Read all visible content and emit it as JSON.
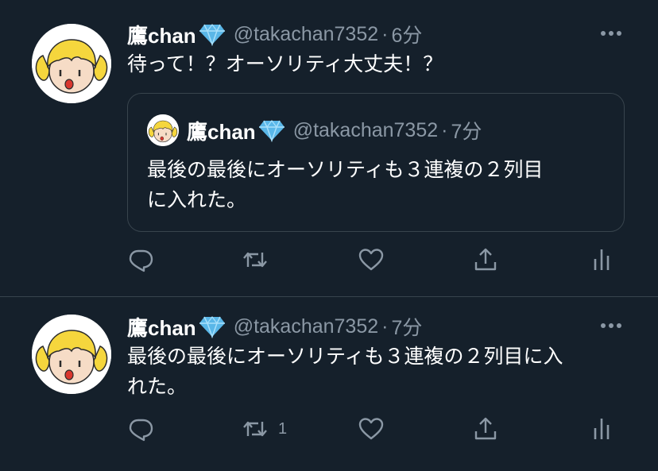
{
  "colors": {
    "background": "#15202b",
    "divider": "#38444d",
    "secondary_text": "#8b98a5",
    "gem_blue": "#5ab7e8"
  },
  "tweets": [
    {
      "author": {
        "name": "鷹chan",
        "badge_icon": "gem-icon",
        "handle": "@takachan7352"
      },
      "dot": "·",
      "time": "6分",
      "text": "待って！？オーソリティ大丈夫！？",
      "quote": {
        "author": {
          "name": "鷹chan",
          "badge_icon": "gem-icon",
          "handle": "@takachan7352"
        },
        "dot": "·",
        "time": "7分",
        "text_line1": "最後の最後にオーソリティも３連複の２列目",
        "text_line2": "に入れた。"
      },
      "actions": {
        "reply": "",
        "retweet": "",
        "like": "",
        "share": "",
        "analytics": ""
      }
    },
    {
      "author": {
        "name": "鷹chan",
        "badge_icon": "gem-icon",
        "handle": "@takachan7352"
      },
      "dot": "·",
      "time": "7分",
      "text_line1": "最後の最後にオーソリティも３連複の２列目に入",
      "text_line2": "れた。",
      "actions": {
        "reply": "",
        "retweet": "1",
        "like": "",
        "share": "",
        "analytics": ""
      }
    }
  ]
}
